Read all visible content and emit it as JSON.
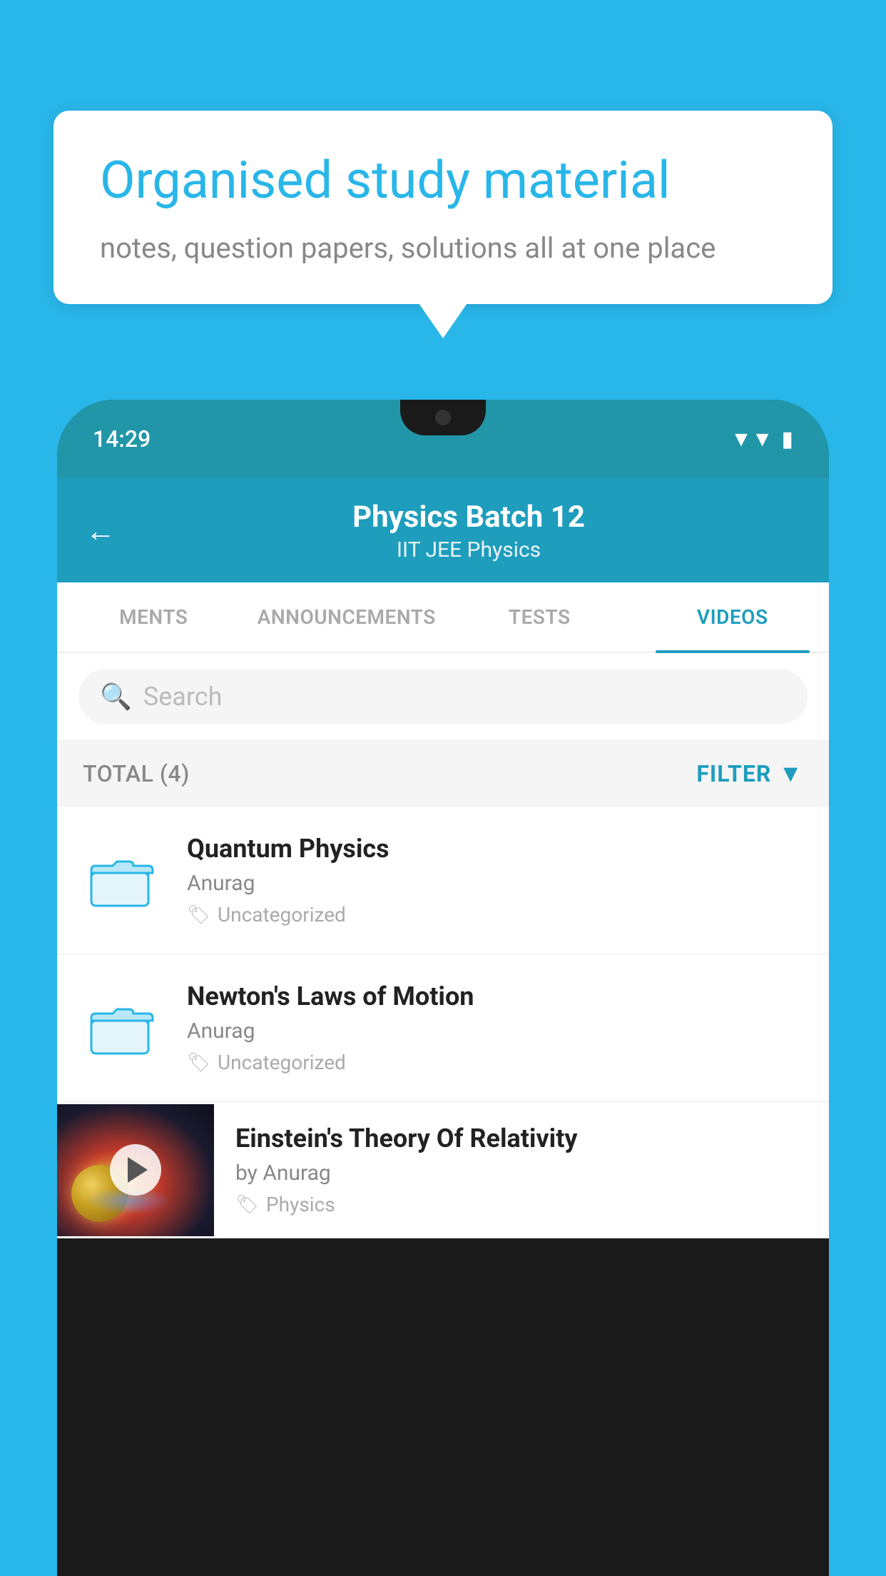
{
  "background": {
    "color": "#29b6e8"
  },
  "speech_bubble": {
    "title": "Organised study material",
    "subtitle": "notes, question papers, solutions all at one place"
  },
  "phone": {
    "status_bar": {
      "time": "14:29"
    },
    "header": {
      "title": "Physics Batch 12",
      "subtitle": "IIT JEE   Physics",
      "back_label": "←"
    },
    "tabs": [
      {
        "label": "MENTS",
        "active": false
      },
      {
        "label": "ANNOUNCEMENTS",
        "active": false
      },
      {
        "label": "TESTS",
        "active": false
      },
      {
        "label": "VIDEOS",
        "active": true
      }
    ],
    "search": {
      "placeholder": "Search"
    },
    "filter_row": {
      "total_label": "TOTAL (4)",
      "filter_label": "FILTER"
    },
    "videos": [
      {
        "title": "Quantum Physics",
        "author": "Anurag",
        "tag": "Uncategorized",
        "has_thumbnail": false
      },
      {
        "title": "Newton's Laws of Motion",
        "author": "Anurag",
        "tag": "Uncategorized",
        "has_thumbnail": false
      },
      {
        "title": "Einstein's Theory Of Relativity",
        "author": "by Anurag",
        "tag": "Physics",
        "has_thumbnail": true
      }
    ]
  }
}
